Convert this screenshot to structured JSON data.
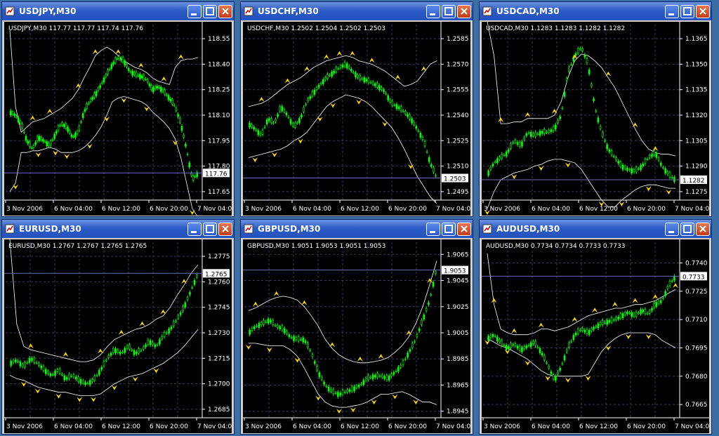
{
  "colors": {
    "candle": "#00ff00",
    "band": "#ffffff",
    "grid": "#3a3a5a",
    "arrow": "#ffd700",
    "priceLine": "#6b6bb8",
    "axisText": "#ffffff"
  },
  "windows": [
    {
      "title": "USDJPY,M30",
      "caption": "USDJPY,M30  117.77 117.77 117.74 117.76",
      "price": "117.76",
      "yticks": [
        "118.55",
        "118.40",
        "118.25",
        "118.10",
        "117.95",
        "117.80",
        "117.65"
      ],
      "xticks": [
        "3 Nov 2006",
        "6 Nov 04:00",
        "6 Nov 12:00",
        "6 Nov 20:00",
        "7 Nov 04:00"
      ],
      "chart_data": {
        "type": "candlestick",
        "ylim": [
          117.6,
          118.6
        ],
        "close": [
          118.12,
          118.1,
          118.05,
          117.95,
          117.9,
          117.97,
          117.95,
          117.92,
          117.99,
          118.05,
          118.03,
          117.97,
          118.0,
          118.12,
          118.18,
          118.22,
          118.28,
          118.34,
          118.4,
          118.44,
          118.42,
          118.36,
          118.34,
          118.33,
          118.31,
          118.25,
          118.27,
          118.24,
          118.2,
          118.15,
          118.05,
          117.9,
          117.72,
          117.76
        ],
        "upper": [
          118.6,
          118.15,
          118.0,
          118.03,
          118.06,
          118.07,
          118.08,
          118.1,
          118.12,
          118.14,
          118.17,
          118.2,
          118.25,
          118.32,
          118.38,
          118.45,
          118.48,
          118.5,
          118.48,
          118.45,
          118.42,
          118.4,
          118.38,
          118.37,
          118.35,
          118.32,
          118.3,
          118.29,
          118.28,
          118.38,
          118.42,
          118.43,
          118.43,
          118.44
        ],
        "lower": [
          117.65,
          117.7,
          117.88,
          117.88,
          117.89,
          117.89,
          117.9,
          117.91,
          117.9,
          117.88,
          117.88,
          117.88,
          117.89,
          117.91,
          117.94,
          117.98,
          118.03,
          118.1,
          118.18,
          118.2,
          118.21,
          118.2,
          118.19,
          118.18,
          118.16,
          118.12,
          118.09,
          118.06,
          118.02,
          117.96,
          117.85,
          117.7,
          117.55,
          117.5
        ],
        "up_arrows": [
          4,
          7,
          12,
          15,
          19,
          23,
          27,
          30
        ],
        "down_arrows": [
          1,
          5,
          8,
          10,
          14,
          17,
          20,
          24,
          29,
          32
        ]
      }
    },
    {
      "title": "USDCHF,M30",
      "caption": "USDCHF,M30  1.2502 1.2504 1.2502 1.2503",
      "price": "1.2503",
      "yticks": [
        "1.2585",
        "1.2570",
        "1.2555",
        "1.2540",
        "1.2525",
        "1.2510",
        "1.2495"
      ],
      "xticks": [
        "3 Nov 2006",
        "6 Nov 04:00",
        "6 Nov 12:00",
        "6 Nov 20:00",
        "7 Nov 04:00"
      ],
      "chart_data": {
        "type": "candlestick",
        "ylim": [
          1.249,
          1.259
        ],
        "close": [
          1.2535,
          1.2532,
          1.2528,
          1.2538,
          1.2535,
          1.2545,
          1.254,
          1.2533,
          1.2538,
          1.2548,
          1.2553,
          1.2558,
          1.2562,
          1.2565,
          1.2568,
          1.257,
          1.2566,
          1.2562,
          1.2561,
          1.2559,
          1.2557,
          1.2554,
          1.2547,
          1.2545,
          1.2542,
          1.2538,
          1.2532,
          1.2525,
          1.2512,
          1.2503
        ],
        "upper": [
          1.2545,
          1.2546,
          1.2547,
          1.2549,
          1.2552,
          1.2555,
          1.2558,
          1.256,
          1.2562,
          1.2565,
          1.2568,
          1.257,
          1.2572,
          1.2573,
          1.2574,
          1.2575,
          1.2574,
          1.2572,
          1.2571,
          1.257,
          1.2568,
          1.2566,
          1.2563,
          1.256,
          1.2557,
          1.2558,
          1.256,
          1.2565,
          1.257,
          1.2572
        ],
        "lower": [
          1.2515,
          1.2516,
          1.2517,
          1.2518,
          1.2519,
          1.252,
          1.2522,
          1.2525,
          1.2527,
          1.253,
          1.2535,
          1.254,
          1.2545,
          1.2548,
          1.255,
          1.2552,
          1.2551,
          1.255,
          1.2548,
          1.2545,
          1.2541,
          1.2537,
          1.2533,
          1.2527,
          1.252,
          1.2512,
          1.2504,
          1.2498,
          1.2492,
          1.2488
        ],
        "up_arrows": [
          2,
          6,
          9,
          12,
          14,
          16,
          19,
          23,
          27
        ],
        "down_arrows": [
          1,
          4,
          8,
          11,
          13,
          17,
          21,
          25
        ]
      }
    },
    {
      "title": "USDCAD,M30",
      "caption": "USDCAD,M30  1.1283 1.1283 1.1282 1.1282",
      "price": "1.1282",
      "yticks": [
        "1.1365",
        "1.1350",
        "1.1335",
        "1.1320",
        "1.1305",
        "1.1290",
        "1.1275"
      ],
      "xticks": [
        "3 Nov 2006",
        "6 Nov 04:00",
        "6 Nov 12:00",
        "6 Nov 20:00",
        "7 Nov 04:00"
      ],
      "chart_data": {
        "type": "candlestick",
        "ylim": [
          1.127,
          1.137
        ],
        "close": [
          1.1285,
          1.1292,
          1.1295,
          1.1298,
          1.1305,
          1.1302,
          1.131,
          1.1308,
          1.131,
          1.131,
          1.1312,
          1.132,
          1.1345,
          1.1355,
          1.136,
          1.135,
          1.1325,
          1.131,
          1.13,
          1.1295,
          1.129,
          1.1288,
          1.1287,
          1.129,
          1.1295,
          1.1298,
          1.129,
          1.1285,
          1.1282
        ],
        "upper": [
          1.1375,
          1.1355,
          1.1315,
          1.1315,
          1.1316,
          1.1316,
          1.1318,
          1.1318,
          1.1318,
          1.1318,
          1.132,
          1.1328,
          1.1342,
          1.1352,
          1.1356,
          1.1355,
          1.1352,
          1.1348,
          1.1342,
          1.1336,
          1.1328,
          1.132,
          1.1312,
          1.1305,
          1.13,
          1.1298,
          1.1297,
          1.1297,
          1.1296
        ],
        "lower": [
          1.1265,
          1.1275,
          1.1282,
          1.1284,
          1.1286,
          1.1287,
          1.1288,
          1.129,
          1.1291,
          1.1293,
          1.1294,
          1.1294,
          1.1293,
          1.1292,
          1.1288,
          1.1282,
          1.1276,
          1.127,
          1.1266,
          1.1266,
          1.127,
          1.1273,
          1.1276,
          1.1278,
          1.1279,
          1.1279,
          1.1278,
          1.1277,
          1.1277
        ],
        "up_arrows": [
          2,
          6,
          10,
          13,
          18,
          22,
          25
        ],
        "down_arrows": [
          0,
          4,
          8,
          12,
          17,
          20,
          24,
          27
        ]
      }
    },
    {
      "title": "EURUSD,M30",
      "caption": "EURUSD,M30  1.2767 1.2767 1.2765 1.2765",
      "price": "1.2765",
      "yticks": [
        "1.2775",
        "1.2760",
        "1.2745",
        "1.2730",
        "1.2715",
        "1.2700",
        "1.2685"
      ],
      "xticks": [
        "3 Nov 2006",
        "6 Nov 04:00",
        "6 Nov 12:00",
        "6 Nov 20:00",
        "7 Nov 04:00"
      ],
      "chart_data": {
        "type": "candlestick",
        "ylim": [
          1.268,
          1.278
        ],
        "close": [
          1.2712,
          1.2714,
          1.271,
          1.2715,
          1.2712,
          1.2708,
          1.2705,
          1.2708,
          1.2703,
          1.2705,
          1.2702,
          1.27,
          1.2702,
          1.2708,
          1.2715,
          1.272,
          1.2718,
          1.2722,
          1.2718,
          1.272,
          1.2725,
          1.2722,
          1.2728,
          1.2732,
          1.2738,
          1.2745,
          1.2755,
          1.2765
        ],
        "upper": [
          1.2785,
          1.2735,
          1.2722,
          1.272,
          1.2719,
          1.2718,
          1.2717,
          1.2716,
          1.2715,
          1.2714,
          1.2713,
          1.2713,
          1.2714,
          1.2717,
          1.2722,
          1.2726,
          1.2728,
          1.273,
          1.2732,
          1.2733,
          1.2735,
          1.2738,
          1.274,
          1.2745,
          1.2752,
          1.2758,
          1.2765,
          1.277
        ],
        "lower": [
          1.2705,
          1.2703,
          1.2702,
          1.27,
          1.2698,
          1.2697,
          1.2696,
          1.2695,
          1.2695,
          1.2694,
          1.2693,
          1.2693,
          1.2693,
          1.2694,
          1.2697,
          1.27,
          1.2702,
          1.2704,
          1.2705,
          1.2706,
          1.2708,
          1.271,
          1.2712,
          1.2715,
          1.2718,
          1.2722,
          1.2727,
          1.2732
        ],
        "up_arrows": [
          0,
          3,
          8,
          13,
          16,
          19,
          22,
          25
        ],
        "down_arrows": [
          2,
          4,
          7,
          10,
          12,
          15,
          18,
          21
        ]
      }
    },
    {
      "title": "GBPUSD,M30",
      "caption": "GBPUSD,M30  1.9051 1.9053 1.9051 1.9053",
      "price": "1.9053",
      "yticks": [
        "1.9065",
        "1.9045",
        "1.9025",
        "1.9005",
        "1.8985",
        "1.8965",
        "1.8945"
      ],
      "xticks": [
        "3 Nov 2006",
        "6 Nov 04:00",
        "6 Nov 12:00",
        "6 Nov 20:00",
        "7 Nov 04:00"
      ],
      "chart_data": {
        "type": "candlestick",
        "ylim": [
          1.894,
          1.907
        ],
        "close": [
          1.9005,
          1.901,
          1.9012,
          1.9015,
          1.901,
          1.9008,
          1.9002,
          1.9,
          1.9,
          1.899,
          1.8975,
          1.8965,
          1.896,
          1.8958,
          1.896,
          1.8962,
          1.8965,
          1.897,
          1.8972,
          1.8972,
          1.897,
          1.8975,
          1.898,
          1.899,
          1.9,
          1.9015,
          1.903,
          1.9055
        ],
        "upper": [
          1.9022,
          1.9024,
          1.9027,
          1.903,
          1.9032,
          1.9033,
          1.9032,
          1.903,
          1.9025,
          1.9018,
          1.901,
          1.9,
          1.8993,
          1.8988,
          1.8985,
          1.8983,
          1.8982,
          1.8982,
          1.8983,
          1.8984,
          1.8986,
          1.899,
          1.8995,
          1.9002,
          1.9012,
          1.9025,
          1.9042,
          1.906
        ],
        "lower": [
          1.8997,
          1.8997,
          1.8996,
          1.8995,
          1.8995,
          1.8995,
          1.8992,
          1.8987,
          1.8978,
          1.8968,
          1.8958,
          1.8952,
          1.8949,
          1.8948,
          1.8948,
          1.8949,
          1.895,
          1.8952,
          1.8955,
          1.8958,
          1.8958,
          1.8959,
          1.896,
          1.8958,
          1.8955,
          1.8952,
          1.8952,
          1.895
        ],
        "up_arrows": [
          1,
          4,
          8,
          12,
          16,
          19,
          23,
          26
        ],
        "down_arrows": [
          0,
          3,
          7,
          10,
          13,
          15,
          18,
          21,
          24
        ]
      }
    },
    {
      "title": "AUDUSD,M30",
      "caption": "AUDUSD,M30  0.7734 0.7734 0.7733 0.7733",
      "price": "0.7733",
      "yticks": [
        "0.7740",
        "0.7725",
        "0.7710",
        "0.7695",
        "0.7680",
        "0.7665"
      ],
      "xticks": [
        "3 Nov 2006",
        "6 Nov 04:00",
        "6 Nov 12:00",
        "6 Nov 20:00",
        "7 Nov 04:00"
      ],
      "chart_data": {
        "type": "candlestick",
        "ylim": [
          0.7658,
          0.7748
        ],
        "close": [
          0.77,
          0.7702,
          0.7698,
          0.7695,
          0.7697,
          0.7694,
          0.7696,
          0.7698,
          0.7693,
          0.7686,
          0.7678,
          0.7685,
          0.7695,
          0.7702,
          0.7705,
          0.7703,
          0.7706,
          0.7708,
          0.7709,
          0.771,
          0.7712,
          0.7714,
          0.7712,
          0.7715,
          0.7713,
          0.7718,
          0.772,
          0.7728,
          0.7733
        ],
        "upper": [
          0.7745,
          0.7718,
          0.7705,
          0.7703,
          0.7702,
          0.7702,
          0.7702,
          0.7703,
          0.7705,
          0.7705,
          0.7704,
          0.7705,
          0.7706,
          0.7708,
          0.771,
          0.7712,
          0.7713,
          0.7714,
          0.7715,
          0.7716,
          0.7716,
          0.7717,
          0.7718,
          0.7718,
          0.7719,
          0.772,
          0.7722,
          0.7724,
          0.7726
        ],
        "lower": [
          0.77,
          0.7698,
          0.7696,
          0.7695,
          0.7693,
          0.7691,
          0.7689,
          0.7686,
          0.7683,
          0.7681,
          0.768,
          0.768,
          0.768,
          0.768,
          0.768,
          0.7681,
          0.7687,
          0.7693,
          0.7697,
          0.77,
          0.7702,
          0.7703,
          0.7703,
          0.7703,
          0.7703,
          0.7702,
          0.7699,
          0.7697,
          0.7695
        ],
        "up_arrows": [
          1,
          4,
          8,
          13,
          16,
          19,
          22,
          25,
          28
        ],
        "down_arrows": [
          0,
          3,
          6,
          9,
          12,
          15,
          18,
          21,
          24
        ]
      }
    }
  ]
}
